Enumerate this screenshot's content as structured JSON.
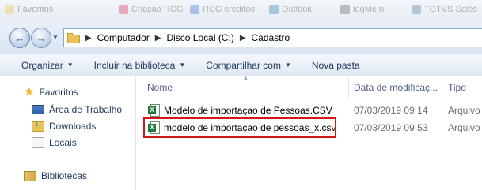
{
  "bookmarks": [
    {
      "label": "Favoritos"
    },
    {
      "label": "Criação RCG"
    },
    {
      "label": "RCG creditos"
    },
    {
      "label": "Outlook"
    },
    {
      "label": "logMeIn"
    },
    {
      "label": "TOTVS Sales"
    }
  ],
  "address": {
    "crumbs": [
      "Computador",
      "Disco Local (C:)",
      "Cadastro"
    ]
  },
  "toolbar": {
    "organize": "Organizar",
    "include_library": "Incluir na biblioteca",
    "share_with": "Compartilhar com",
    "new_folder": "Nova pasta"
  },
  "nav": {
    "favorites": "Favoritos",
    "desktop": "Área de Trabalho",
    "downloads": "Downloads",
    "locations": "Locais",
    "libraries": "Bibliotecas"
  },
  "columns": {
    "name": "Nome",
    "date": "Data de modificaç...",
    "type": "Tipo"
  },
  "files": [
    {
      "name": "Modelo de importaçao de Pessoas.CSV",
      "date": "07/03/2019 09:14",
      "type": "Arquivo"
    },
    {
      "name": "modelo de importaçao de pessoas_x.csv",
      "date": "07/03/2019 09:53",
      "type": "Arquivo"
    }
  ],
  "colors": {
    "highlight": "#d01919",
    "excel_green": "#1f7a3a"
  }
}
